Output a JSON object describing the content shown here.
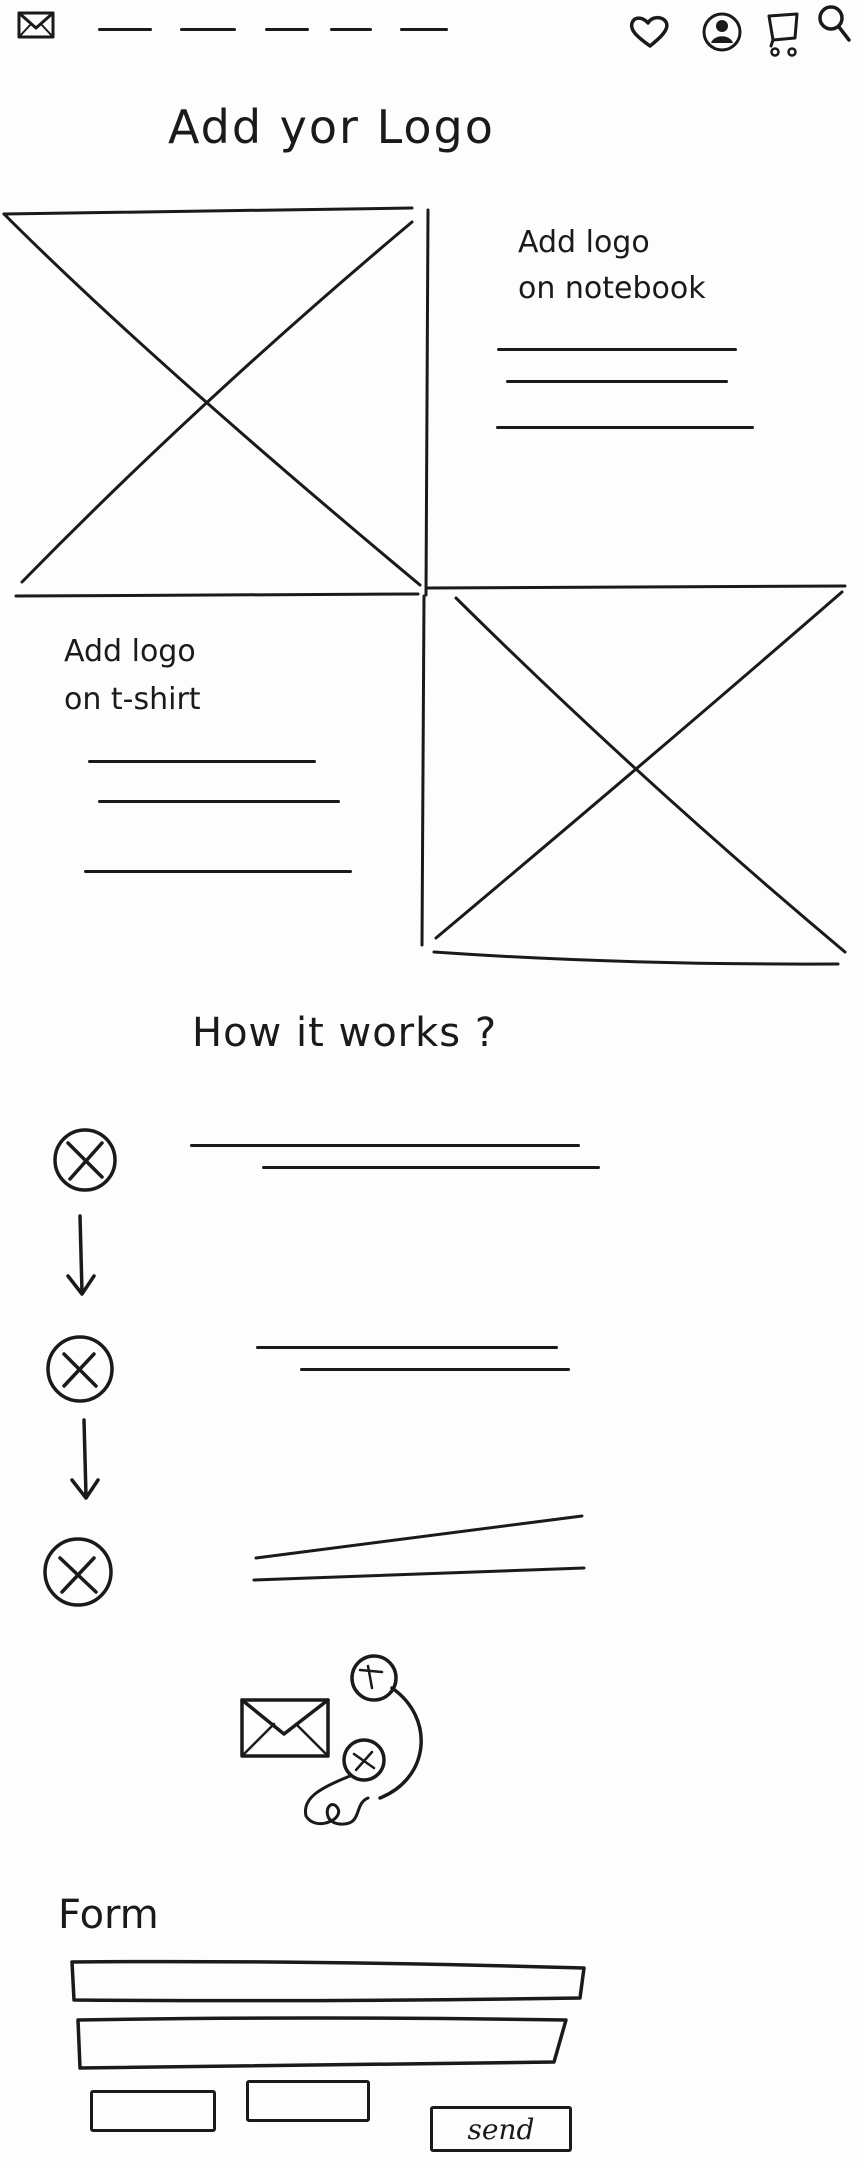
{
  "page": {
    "title": "Add yor Logo",
    "nav_items": [
      "",
      "",
      "",
      "",
      ""
    ],
    "icons": [
      "mail-icon",
      "heart-icon",
      "user-icon",
      "cart-icon",
      "search-icon"
    ]
  },
  "sections": {
    "notebook": {
      "title_line1": "Add logo",
      "title_line2": "on notebook"
    },
    "tshirt": {
      "title_line1": "Add logo",
      "title_line2": "on t-shirt"
    },
    "how": {
      "title": "How it works ?"
    },
    "contact": {
      "icons": [
        "mail-icon",
        "headset-icon"
      ]
    }
  },
  "form": {
    "title": "Form",
    "send_label": "send"
  },
  "colors": {
    "ink": "#1a1a1a",
    "paper": "#fdfdfd"
  }
}
